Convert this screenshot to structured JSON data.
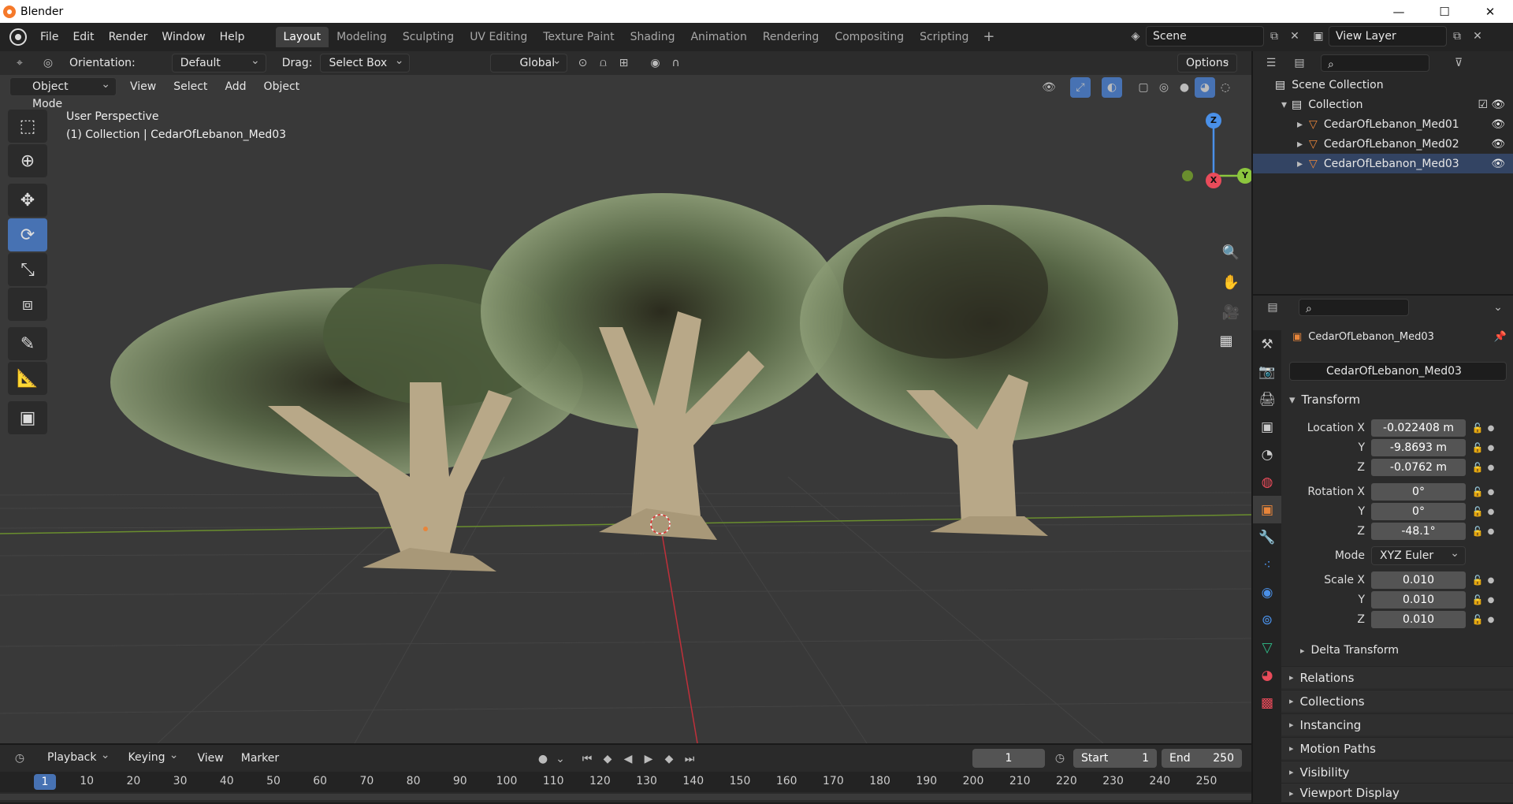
{
  "window": {
    "title": "Blender",
    "minimize": "—",
    "maximize": "☐",
    "close": "✕"
  },
  "menu": [
    "File",
    "Edit",
    "Render",
    "Window",
    "Help"
  ],
  "workspaces": [
    "Layout",
    "Modeling",
    "Sculpting",
    "UV Editing",
    "Texture Paint",
    "Shading",
    "Animation",
    "Rendering",
    "Compositing",
    "Scripting"
  ],
  "workspace_add": "+",
  "scene": "Scene",
  "view_layer": "View Layer",
  "viewport_header": {
    "orientation_label": "Orientation:",
    "orientation_value": "Default",
    "drag_label": "Drag:",
    "drag_value": "Select Box",
    "transform_orientation": "Global",
    "options": "Options"
  },
  "viewport_header2": {
    "mode": "Object Mode",
    "menus": [
      "View",
      "Select",
      "Add",
      "Object"
    ]
  },
  "overlay": {
    "perspective": "User Perspective",
    "collection": "(1) Collection | CedarOfLebanon_Med03"
  },
  "gizmo": {
    "x": "X",
    "y": "Y",
    "z": "Z"
  },
  "outliner": {
    "scene_collection": "Scene Collection",
    "collection": "Collection",
    "objects": [
      "CedarOfLebanon_Med01",
      "CedarOfLebanon_Med02",
      "CedarOfLebanon_Med03"
    ]
  },
  "properties": {
    "object_name": "CedarOfLebanon_Med03",
    "object_field": "CedarOfLebanon_Med03",
    "transform": "Transform",
    "location_label": "Location X",
    "location": [
      "-0.022408 m",
      "-9.8693 m",
      "-0.0762 m"
    ],
    "rotation_label": "Rotation X",
    "rotation": [
      "0°",
      "0°",
      "-48.1°"
    ],
    "mode_label": "Mode",
    "mode_value": "XYZ Euler",
    "scale_label": "Scale X",
    "scale": [
      "0.010",
      "0.010",
      "0.010"
    ],
    "axis_y": "Y",
    "axis_z": "Z",
    "delta": "Delta Transform",
    "sections": [
      "Relations",
      "Collections",
      "Instancing",
      "Motion Paths",
      "Visibility",
      "Viewport Display"
    ]
  },
  "timeline": {
    "menus": [
      "Playback",
      "Keying",
      "View",
      "Marker"
    ],
    "current_frame": "1",
    "start_label": "Start",
    "start": "1",
    "end_label": "End",
    "end": "250",
    "ruler": [
      "1",
      "10",
      "20",
      "30",
      "40",
      "50",
      "60",
      "70",
      "80",
      "90",
      "100",
      "110",
      "120",
      "130",
      "140",
      "150",
      "160",
      "170",
      "180",
      "190",
      "200",
      "210",
      "220",
      "230",
      "240",
      "250"
    ]
  },
  "colors": {
    "accent": "#4772b3",
    "x_axis": "#e94b5a",
    "y_axis": "#8cc63e",
    "z_axis": "#4a90e8",
    "object_orange": "#e8853a"
  }
}
